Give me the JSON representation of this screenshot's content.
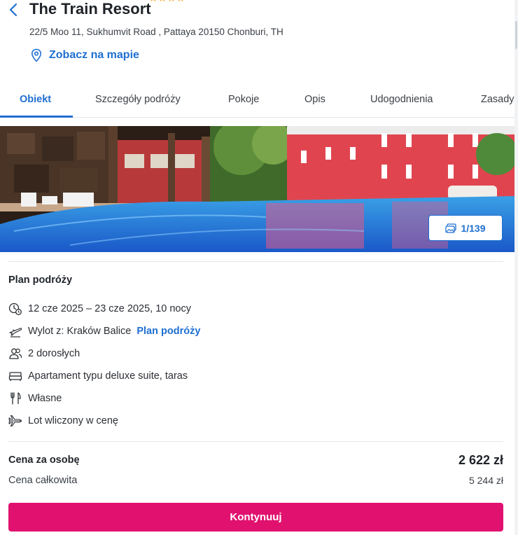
{
  "hotel": {
    "name": "The Train Resort",
    "stars": 4,
    "address": "22/5 Moo 11, Sukhumvit Road , Pattaya 20150 Chonburi, TH",
    "map_link_label": "Zobacz na mapie"
  },
  "tabs": [
    {
      "label": "Obiekt",
      "active": true
    },
    {
      "label": "Szczegóły podróży",
      "active": false
    },
    {
      "label": "Pokoje",
      "active": false
    },
    {
      "label": "Opis",
      "active": false
    },
    {
      "label": "Udogodnienia",
      "active": false
    },
    {
      "label": "Zasady",
      "active": false
    }
  ],
  "gallery": {
    "counter": "1/139"
  },
  "plan": {
    "title": "Plan podróży",
    "dates": "12 cze 2025 – 23 cze 2025, 10 nocy",
    "departure": "Wylot z: Kraków Balice",
    "departure_link": "Plan podróży",
    "guests": "2 dorosłych",
    "room": "Apartament typu deluxe suite, taras",
    "board": "Własne",
    "flight": "Lot wliczony w cenę"
  },
  "price": {
    "per_person_label": "Cena za osobę",
    "per_person_value": "2 622 zł",
    "total_label": "Cena całkowita",
    "total_value": "5 244 zł"
  },
  "cta": {
    "label": "Kontynuuj"
  },
  "colors": {
    "accent": "#1f6fd1",
    "cta": "#e0116f",
    "star": "#f5a524"
  },
  "icons": {
    "back": "chevron-left-icon",
    "star": "star-icon",
    "map": "map-pin-icon",
    "gallery": "photos-icon",
    "dates": "calendar-clock-icon",
    "departure": "plane-departure-icon",
    "guests": "people-icon",
    "room": "bed-icon",
    "board": "fork-knife-icon",
    "flight": "airplane-icon"
  }
}
